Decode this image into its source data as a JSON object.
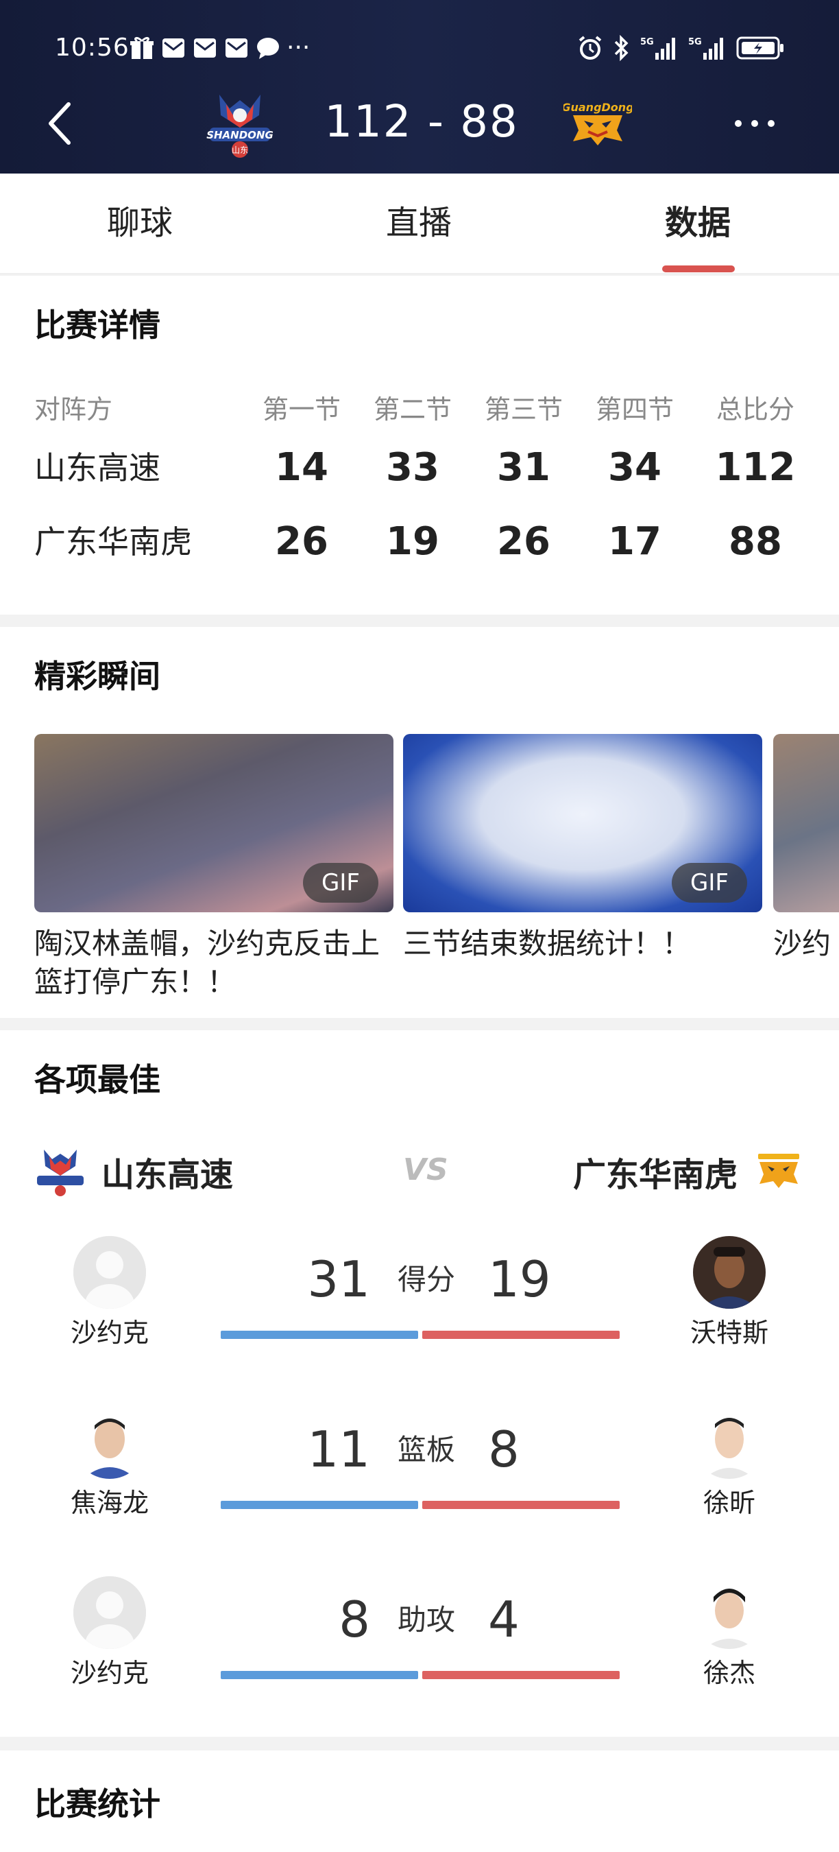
{
  "status_bar": {
    "time": "10:56",
    "left_icons": [
      "gift-icon",
      "mail-icon",
      "mail-icon",
      "mail-icon",
      "chat-icon",
      "more-dots-icon"
    ],
    "right_icons": [
      "alarm-icon",
      "bluetooth-icon",
      "signal-5g-icon",
      "signal-5g-icon",
      "battery-icon"
    ],
    "more": "···"
  },
  "header": {
    "home_score": "112",
    "separator": "-",
    "away_score": "88",
    "score_text": "112  -  88",
    "home_logo_text": "SHANDONG",
    "home_logo_sub": "山东",
    "away_logo_text": "GuangDong"
  },
  "tabs": [
    {
      "label": "聊球",
      "active": false
    },
    {
      "label": "直播",
      "active": false
    },
    {
      "label": "数据",
      "active": true
    }
  ],
  "details": {
    "title": "比赛详情",
    "headers": [
      "对阵方",
      "第一节",
      "第二节",
      "第三节",
      "第四节",
      "总比分"
    ],
    "rows": [
      {
        "team": "山东高速",
        "q": [
          "14",
          "33",
          "31",
          "34"
        ],
        "total": "112"
      },
      {
        "team": "广东华南虎",
        "q": [
          "26",
          "19",
          "26",
          "17"
        ],
        "total": "88"
      }
    ]
  },
  "highlights": {
    "title": "精彩瞬间",
    "items": [
      {
        "caption": "陶汉林盖帽，沙约克反击上篮打停广东！！",
        "badge": "GIF"
      },
      {
        "caption": "三节结束数据统计！！",
        "badge": "GIF"
      },
      {
        "caption": "沙约",
        "badge": ""
      }
    ]
  },
  "best": {
    "title": "各项最佳",
    "home_team": "山东高速",
    "away_team": "广东华南虎",
    "vs": "VS",
    "stats": [
      {
        "label": "得分",
        "home_player": "沙约克",
        "home_value": "31",
        "away_player": "沃特斯",
        "away_value": "19"
      },
      {
        "label": "篮板",
        "home_player": "焦海龙",
        "home_value": "11",
        "away_player": "徐昕",
        "away_value": "8"
      },
      {
        "label": "助攻",
        "home_player": "沙约克",
        "home_value": "8",
        "away_player": "徐杰",
        "away_value": "4"
      }
    ]
  },
  "game_stats": {
    "title": "比赛统计"
  },
  "colors": {
    "header_bg": "#1b2447",
    "accent": "#d9534f",
    "home_bar": "#5b9bdb",
    "away_bar": "#dd6160"
  }
}
